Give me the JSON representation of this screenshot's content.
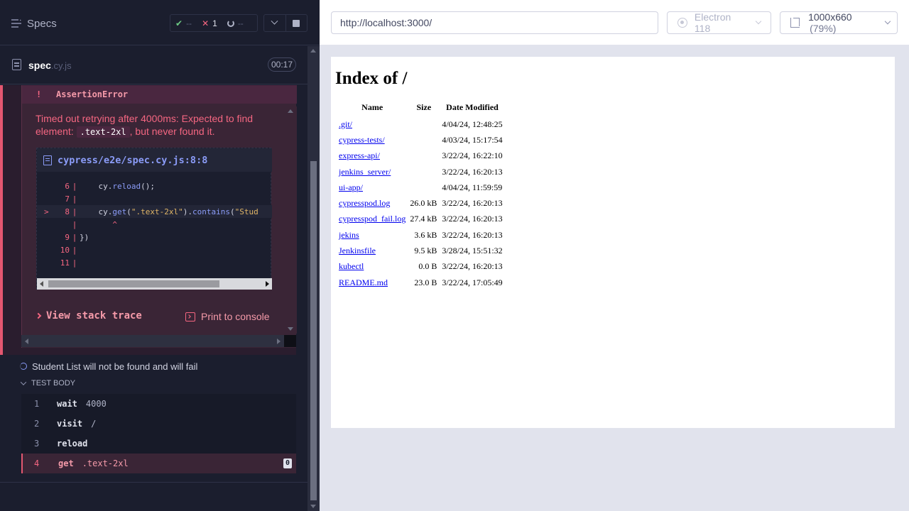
{
  "header": {
    "specs_label": "Specs",
    "passed": "--",
    "failed": "1",
    "pending": "--"
  },
  "spec": {
    "name": "spec",
    "ext": ".cy.js",
    "duration": "00:17"
  },
  "error": {
    "type": "AssertionError",
    "bang": "!",
    "message_before": "Timed out retrying after 4000ms: Expected to find element:",
    "selector": ".text-2xl",
    "message_after": ", but never found it.",
    "file": "cypress/e2e/spec.cy.js:8:8",
    "code_lines": [
      {
        "num": "6",
        "code_obj": "cy.",
        "code_fn": "reload",
        "code_rest": "();"
      },
      {
        "num": "7"
      },
      {
        "num": "8",
        "pointer": ">",
        "code_obj": "cy.",
        "code_fn": "get",
        "code_str1": "\".text-2xl\"",
        "code_mid": ").",
        "code_fn2": "contains",
        "code_str2": "\"Stud"
      },
      {
        "caret": "^"
      },
      {
        "num": "9",
        "code_plain": "})"
      },
      {
        "num": "10"
      },
      {
        "num": "11"
      }
    ],
    "view_stack": "View stack trace",
    "print_console": "Print to console"
  },
  "test": {
    "title": "Student List will not be found and will fail",
    "body_label": "TEST BODY",
    "commands": [
      {
        "n": "1",
        "name": "wait",
        "arg": "4000"
      },
      {
        "n": "2",
        "name": "visit",
        "arg": "/"
      },
      {
        "n": "3",
        "name": "reload",
        "arg": ""
      },
      {
        "n": "4",
        "name": "get",
        "arg": ".text-2xl",
        "badge": "0"
      }
    ]
  },
  "aut": {
    "url": "http://localhost:3000/",
    "browser": "Electron 118",
    "viewport": "1000x660",
    "scale": "(79%)"
  },
  "page": {
    "title": "Index of /",
    "columns": [
      "Name",
      "Size",
      "Date Modified"
    ],
    "rows": [
      {
        "name": ".git/",
        "size": "",
        "date": "4/04/24, 12:48:25"
      },
      {
        "name": "cypress-tests/",
        "size": "",
        "date": "4/03/24, 15:17:54"
      },
      {
        "name": "express-api/",
        "size": "",
        "date": "3/22/24, 16:22:10"
      },
      {
        "name": "jenkins_server/",
        "size": "",
        "date": "3/22/24, 16:20:13"
      },
      {
        "name": "ui-app/",
        "size": "",
        "date": "4/04/24, 11:59:59"
      },
      {
        "name": "cypresspod.log",
        "size": "26.0 kB",
        "date": "3/22/24, 16:20:13"
      },
      {
        "name": "cypresspod_fail.log",
        "size": "27.4 kB",
        "date": "3/22/24, 16:20:13"
      },
      {
        "name": "jekins",
        "size": "3.6 kB",
        "date": "3/22/24, 16:20:13"
      },
      {
        "name": "Jenkinsfile",
        "size": "9.5 kB",
        "date": "3/28/24, 15:51:32"
      },
      {
        "name": "kubectl",
        "size": "0.0 B",
        "date": "3/22/24, 16:20:13"
      },
      {
        "name": "README.md",
        "size": "23.0 B",
        "date": "3/22/24, 17:05:49"
      }
    ]
  }
}
